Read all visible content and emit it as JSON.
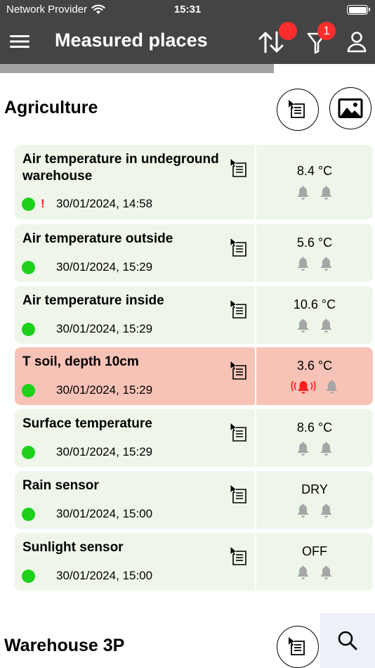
{
  "status_bar": {
    "carrier": "Network Provider",
    "time": "15:31"
  },
  "header": {
    "title": "Measured places",
    "filter_count": "1"
  },
  "progress": {
    "fraction": 0.73
  },
  "sections": [
    {
      "title": "Agriculture",
      "items": [
        {
          "title": "Air temperature in undeground warehouse",
          "warning": "!",
          "timestamp": "30/01/2024, 14:58",
          "value": "8.4 °C"
        },
        {
          "title": "Air temperature outside",
          "warning": "",
          "timestamp": "30/01/2024, 15:29",
          "value": "5.6 °C"
        },
        {
          "title": "Air temperature inside",
          "warning": "",
          "timestamp": "30/01/2024, 15:29",
          "value": "10.6 °C"
        },
        {
          "title": "T soil, depth 10cm",
          "warning": "",
          "timestamp": "30/01/2024, 15:29",
          "value": "3.6 °C"
        },
        {
          "title": "Surface temperature",
          "warning": "",
          "timestamp": "30/01/2024, 15:29",
          "value": "8.6 °C"
        },
        {
          "title": "Rain sensor",
          "warning": "",
          "timestamp": "30/01/2024, 15:00",
          "value": "DRY"
        },
        {
          "title": "Sunlight sensor",
          "warning": "",
          "timestamp": "30/01/2024, 15:00",
          "value": "OFF"
        }
      ]
    },
    {
      "title": "Warehouse 3P"
    }
  ],
  "colors": {
    "header_bg": "#444444",
    "card_normal": "#eef6e9",
    "card_alarm": "#f8c3b7",
    "status_ok": "#1cd01c",
    "alarm_red": "#ff2020",
    "bell_inactive": "#a6a6a6"
  },
  "icons": [
    "wifi-icon",
    "battery-icon",
    "menu-icon",
    "sort-icon",
    "filter-icon",
    "profile-icon",
    "report-icon",
    "image-icon",
    "bell-icon",
    "bell-ringing-icon",
    "search-icon"
  ]
}
